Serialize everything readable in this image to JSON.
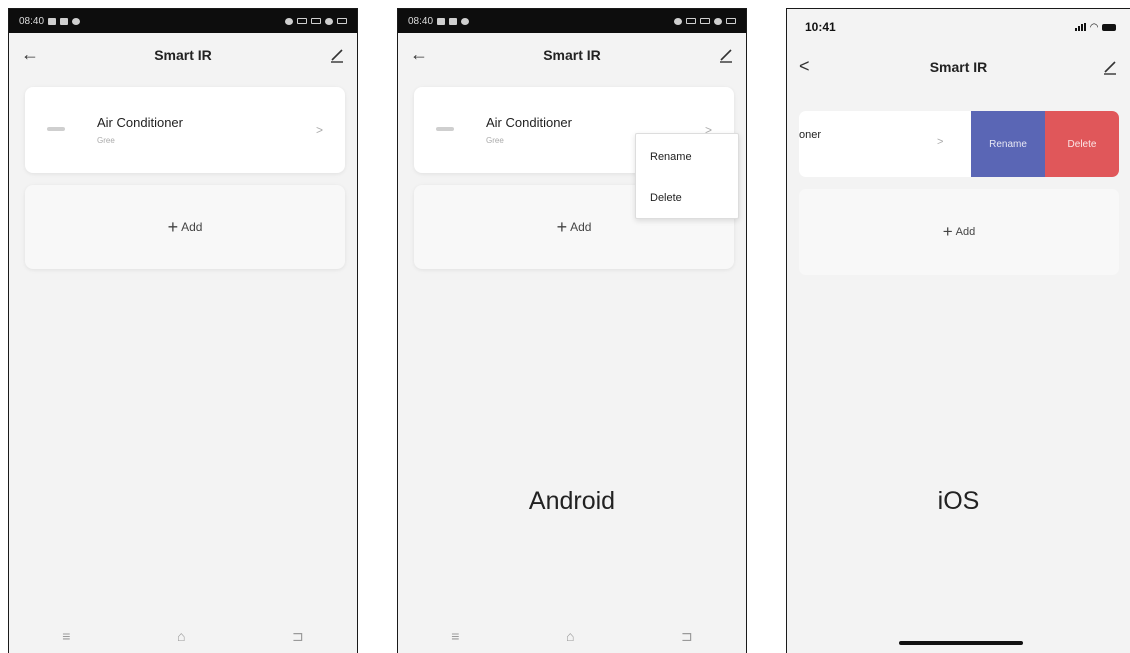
{
  "android": {
    "status_time": "08:40",
    "header_title": "Smart IR",
    "back_glyph": "←",
    "device_name": "Air Conditioner",
    "device_brand": "Gree",
    "chevron": ">",
    "add_plus": "+",
    "add_label": "Add",
    "nav": {
      "menu": "≡",
      "home": "⌂",
      "back": "⊐"
    },
    "menu_items": [
      "Rename",
      "Delete"
    ],
    "os_label": "Android"
  },
  "ios": {
    "status_time": "10:41",
    "header_title": "Smart IR",
    "back_glyph": "<",
    "device_partial": "oner",
    "chevron": ">",
    "rename_label": "Rename",
    "delete_label": "Delete",
    "add_plus": "+",
    "add_label": "Add",
    "os_label": "iOS"
  },
  "colors": {
    "rename_bg": "#5a66b5",
    "delete_bg": "#e0575a"
  },
  "icons": [
    "back-arrow-icon",
    "edit-pencil-icon",
    "air-conditioner-icon",
    "chevron-right-icon",
    "plus-icon"
  ]
}
